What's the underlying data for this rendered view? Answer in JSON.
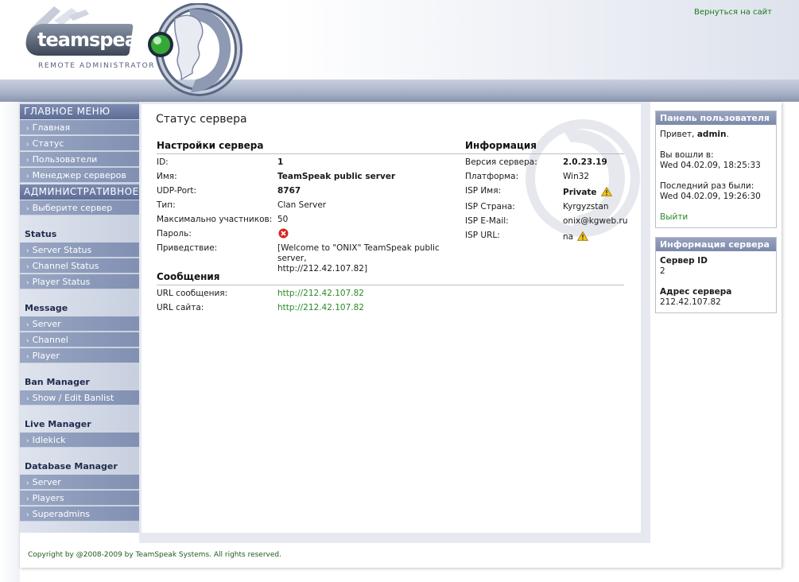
{
  "header": {
    "logo_text": "teamspeak",
    "logo_sub": "REMOTE ADMINISTRATOR",
    "back_link": "Вернуться на сайт"
  },
  "sidebar": {
    "main_menu_title": "ГЛАВНОЕ МЕНЮ",
    "main_menu": [
      "Главная",
      "Статус",
      "Пользователи",
      "Менеджер серверов"
    ],
    "admin_title": "АДМИНИСТРАТИВНОЕ",
    "admin_items": [
      "Выберите сервер"
    ],
    "sections": [
      {
        "title": "Status",
        "items": [
          "Server Status",
          "Channel Status",
          "Player Status"
        ]
      },
      {
        "title": "Message",
        "items": [
          "Server",
          "Channel",
          "Player"
        ]
      },
      {
        "title": "Ban Manager",
        "items": [
          "Show / Edit Banlist"
        ]
      },
      {
        "title": "Live Manager",
        "items": [
          "Idlekick"
        ]
      },
      {
        "title": "Database Manager",
        "items": [
          "Server",
          "Players",
          "Superadmins"
        ]
      }
    ]
  },
  "main": {
    "page_title": "Статус сервера",
    "settings_title": "Настройки сервера",
    "settings": [
      {
        "label": "ID:",
        "value": "1",
        "bold": true
      },
      {
        "label": "Имя:",
        "value": "TeamSpeak public server",
        "bold": true
      },
      {
        "label": "UDP-Port:",
        "value": "8767",
        "bold": true
      },
      {
        "label": "Тип:",
        "value": "Clan Server",
        "bold": false
      },
      {
        "label": "Максимально участников:",
        "value": "50",
        "bold": false
      },
      {
        "label": "Пароль:",
        "value": "",
        "bold": false
      },
      {
        "label": "Приведствие:",
        "value": "[Welcome to \"ONIX\" TeamSpeak public server,",
        "value2": "http://212.42.107.82]",
        "bold": false
      }
    ],
    "info_title": "Информация",
    "info": [
      {
        "label": "Версия сервера:",
        "value": "2.0.23.19",
        "bold": true
      },
      {
        "label": "Платформа:",
        "value": "Win32",
        "bold": false
      },
      {
        "label": "ISP Имя:",
        "value": "Private",
        "bold": true
      },
      {
        "label": "ISP Страна:",
        "value": "Kyrgyzstan",
        "bold": false
      },
      {
        "label": "ISP E-Mail:",
        "value": "onix@kgweb.ru",
        "bold": false
      },
      {
        "label": "ISP URL:",
        "value": "na",
        "bold": false
      }
    ],
    "messages_title": "Сообщения",
    "messages": [
      {
        "label": "URL сообщения:",
        "value": "http://212.42.107.82"
      },
      {
        "label": "URL сайта:",
        "value": "http://212.42.107.82"
      }
    ]
  },
  "user_panel": {
    "title": "Панель пользователя",
    "greeting_prefix": "Привет,",
    "username": "admin",
    "greeting_suffix": ".",
    "login_label": "Вы вошли в:",
    "login_time": "Wed 04.02.09, 18:25:33",
    "last_label": "Последний раз были:",
    "last_time": "Wed 04.02.09, 19:26:30",
    "logout": "Выйти"
  },
  "server_panel": {
    "title": "Информация сервера",
    "id_label": "Сервер ID",
    "id_value": "2",
    "address_label": "Адрес сервера",
    "address_value": "212.42.107.82"
  },
  "footer": {
    "copyright": "Copyright by @2008-2009 by TeamSpeak Systems. All rights reserved."
  },
  "colors": {
    "accent_link": "#2a8a2a",
    "sidebar_item": "#8b99b9",
    "panel_head": "#8a96b4"
  }
}
